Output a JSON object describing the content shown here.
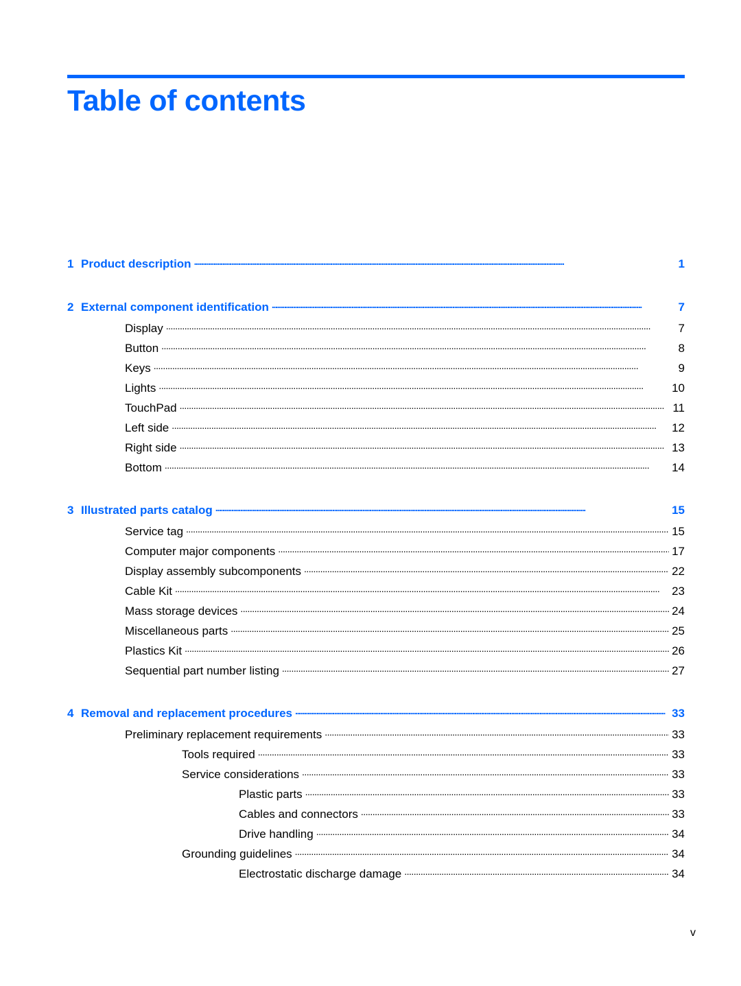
{
  "page": {
    "title": "Table of contents",
    "folio": "v",
    "accent_color": "#0066ff"
  },
  "toc": {
    "chapters": [
      {
        "number": "1",
        "title": "Product description",
        "page": "1",
        "entries": []
      },
      {
        "number": "2",
        "title": "External component identification",
        "page": "7",
        "entries": [
          {
            "title": "Display",
            "page": "7",
            "level": 1
          },
          {
            "title": "Button",
            "page": "8",
            "level": 1
          },
          {
            "title": "Keys",
            "page": "9",
            "level": 1
          },
          {
            "title": "Lights",
            "page": "10",
            "level": 1
          },
          {
            "title": "TouchPad",
            "page": "11",
            "level": 1
          },
          {
            "title": "Left side",
            "page": "12",
            "level": 1
          },
          {
            "title": "Right side",
            "page": "13",
            "level": 1
          },
          {
            "title": "Bottom",
            "page": "14",
            "level": 1
          }
        ]
      },
      {
        "number": "3",
        "title": "Illustrated parts catalog",
        "page": "15",
        "entries": [
          {
            "title": "Service tag",
            "page": "15",
            "level": 1
          },
          {
            "title": "Computer major components",
            "page": "17",
            "level": 1
          },
          {
            "title": "Display assembly subcomponents",
            "page": "22",
            "level": 1
          },
          {
            "title": "Cable Kit",
            "page": "23",
            "level": 1
          },
          {
            "title": "Mass storage devices",
            "page": "24",
            "level": 1
          },
          {
            "title": "Miscellaneous parts",
            "page": "25",
            "level": 1
          },
          {
            "title": "Plastics Kit",
            "page": "26",
            "level": 1
          },
          {
            "title": "Sequential part number listing",
            "page": "27",
            "level": 1
          }
        ]
      },
      {
        "number": "4",
        "title": "Removal and replacement procedures",
        "page": "33",
        "entries": [
          {
            "title": "Preliminary replacement requirements",
            "page": "33",
            "level": 1
          },
          {
            "title": "Tools required",
            "page": "33",
            "level": 2
          },
          {
            "title": "Service considerations",
            "page": "33",
            "level": 2
          },
          {
            "title": "Plastic parts",
            "page": "33",
            "level": 3
          },
          {
            "title": "Cables and connectors",
            "page": "33",
            "level": 3
          },
          {
            "title": "Drive handling",
            "page": "34",
            "level": 3
          },
          {
            "title": "Grounding guidelines",
            "page": "34",
            "level": 2
          },
          {
            "title": "Electrostatic discharge damage",
            "page": "34",
            "level": 3
          }
        ]
      }
    ]
  }
}
